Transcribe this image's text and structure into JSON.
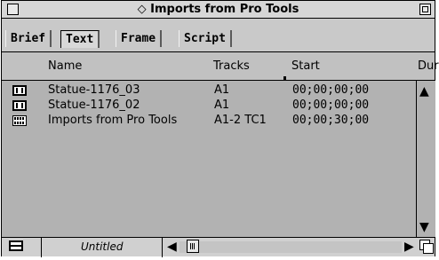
{
  "window": {
    "title": "◇ Imports from Pro Tools"
  },
  "tabs": [
    {
      "label": "Brief"
    },
    {
      "label": "Text"
    },
    {
      "label": "Frame"
    },
    {
      "label": "Script"
    }
  ],
  "active_tab": "Text",
  "columns": [
    {
      "label": "Name"
    },
    {
      "label": "Tracks"
    },
    {
      "label": "Start"
    },
    {
      "label": "Dur"
    }
  ],
  "rows": [
    {
      "icon": "audio-clip-icon",
      "name": "Statue-1176_03",
      "tracks": "A1",
      "start": "00;00;00;00"
    },
    {
      "icon": "audio-clip-icon",
      "name": "Statue-1176_02",
      "tracks": "A1",
      "start": "00;00;00;00"
    },
    {
      "icon": "sequence-icon",
      "name": "Imports from Pro Tools",
      "tracks": "A1-2 TC1",
      "start": "00;00;30;00"
    }
  ],
  "bottom": {
    "bin_view_name": "Untitled"
  },
  "glyphs": {
    "up": "🡅",
    "down": "🡇",
    "left": "🡄",
    "right": "🡆"
  }
}
